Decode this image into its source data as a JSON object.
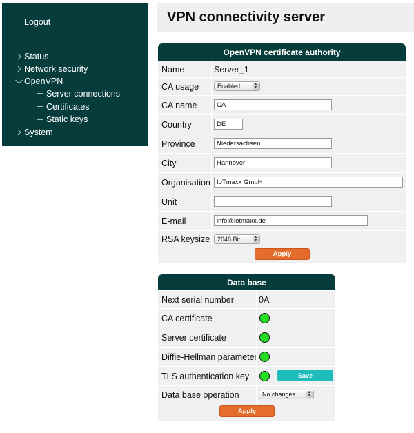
{
  "sidebar": {
    "logout": "Logout",
    "items": [
      {
        "label": "Status",
        "expanded": false
      },
      {
        "label": "Network security",
        "expanded": false
      },
      {
        "label": "OpenVPN",
        "expanded": true
      },
      {
        "label": "System",
        "expanded": false
      }
    ],
    "openvpn_children": [
      {
        "label": "Server connections"
      },
      {
        "label": "Certificates"
      },
      {
        "label": "Static keys"
      }
    ]
  },
  "page": {
    "title": "VPN connectivity server"
  },
  "ca_panel": {
    "title": "OpenVPN certificate authority",
    "name_label": "Name",
    "name_value": "Server_1",
    "ca_usage_label": "CA usage",
    "ca_usage_value": "Enabled",
    "ca_name_label": "CA name",
    "ca_name_value": "CA",
    "country_label": "Country",
    "country_value": "DE",
    "province_label": "Province",
    "province_value": "Niedersachsen",
    "city_label": "City",
    "city_value": "Hannover",
    "organisation_label": "Organisation",
    "organisation_value": "IoTmaxx GmbH",
    "unit_label": "Unit",
    "unit_value": "",
    "email_label": "E-mail",
    "email_value": "info@iotmaxx.de",
    "rsa_label": "RSA keysize",
    "rsa_value": "2048 Bit",
    "apply_label": "Apply"
  },
  "db_panel": {
    "title": "Data base",
    "serial_label": "Next serial number",
    "serial_value": "0A",
    "ca_cert_label": "CA certificate",
    "server_cert_label": "Server certificate",
    "dh_label": "Diffie-Hellman parameter",
    "tls_label": "TLS authentication key",
    "save_label": "Save",
    "operation_label": "Data base operation",
    "operation_value": "No changes",
    "apply_label": "Apply",
    "status_color": "#22dd22"
  }
}
